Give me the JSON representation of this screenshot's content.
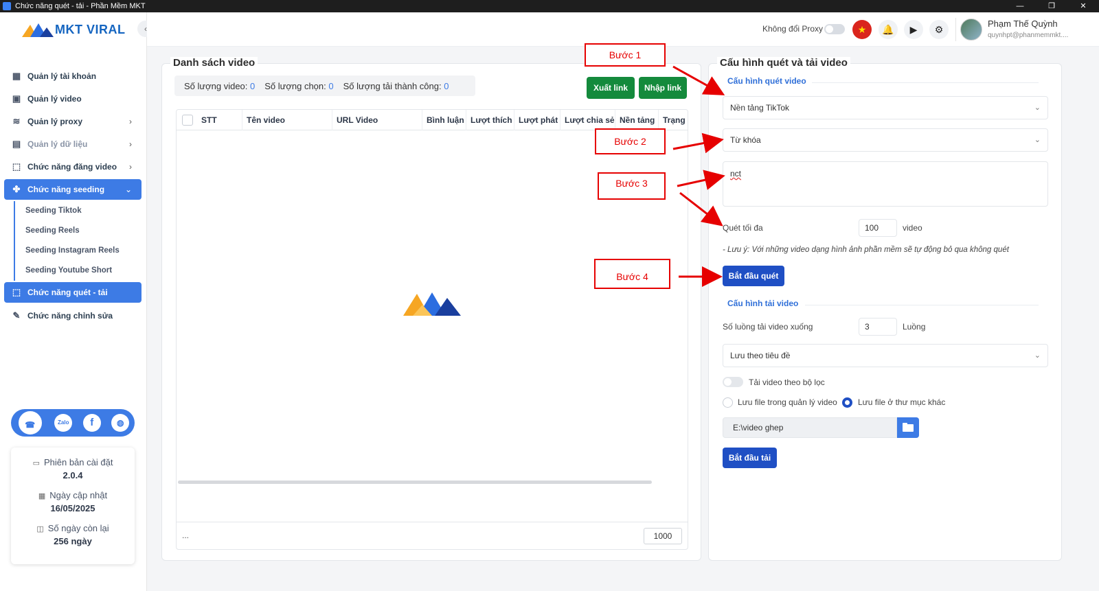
{
  "window": {
    "title": "Chức năng quét - tải - Phần Mềm MKT",
    "controls": [
      "—",
      "❐",
      "✕"
    ]
  },
  "brand": {
    "logo_text": "MKT VIRAL",
    "colors": {
      "orange": "#f6a623",
      "blue": "#1565c0"
    }
  },
  "sidebar": {
    "collapse_icon": "‹",
    "items": [
      {
        "label": "Quản lý tài khoản",
        "icon": "▦"
      },
      {
        "label": "Quản lý video",
        "icon": "▣"
      },
      {
        "label": "Quản lý proxy",
        "icon": "≋",
        "chevron": "›"
      },
      {
        "label": "Quản lý dữ liệu",
        "icon": "▤",
        "chevron": "›"
      },
      {
        "label": "Chức năng đăng video",
        "icon": "⬚",
        "chevron": "›"
      },
      {
        "label": "Chức năng seeding",
        "icon": "✤",
        "chevron": "⌄"
      }
    ],
    "sub_items": [
      "Seeding Tiktok",
      "Seeding Reels",
      "Seeding Instagram Reels",
      "Seeding Youtube Short"
    ],
    "items_after": [
      {
        "label": "Chức năng quét - tải",
        "icon": "⬚"
      },
      {
        "label": "Chức năng chỉnh sửa",
        "icon": "✎"
      }
    ],
    "social": [
      "☎",
      "Zalo",
      "f",
      "◍"
    ],
    "info": {
      "version_label": "Phiên bản cài đặt",
      "version": "2.0.4",
      "update_label": "Ngày cập nhật",
      "update_date": "16/05/2025",
      "days_label": "Số ngày còn lại",
      "days_value": "256 ngày"
    }
  },
  "header": {
    "proxy_label": "Không đổi Proxy",
    "flag": "★",
    "bell": "🔔",
    "play": "▶",
    "gear": "⚙",
    "user_name": "Phạm Thế Quỳnh",
    "user_email": "quynhpt@phanmemmkt...."
  },
  "left_panel": {
    "title": "Danh sách video",
    "count_video_label": "Số lượng video:",
    "count_video": "0",
    "count_selected_label": "Số lượng chọn:",
    "count_selected": "0",
    "count_success_label": "Số lượng tải thành công:",
    "count_success": "0",
    "export_label": "Xuất link",
    "import_label": "Nhập link",
    "columns": [
      "STT",
      "Tên video",
      "URL Video",
      "Bình luận",
      "Lượt thích",
      "Lượt phát",
      "Lượt chia sẻ",
      "Nền tảng",
      "Trạng"
    ],
    "footer_dots": "...",
    "page_size": "1000"
  },
  "right_panel": {
    "title": "Cấu hình quét và tải video",
    "scan_section": "Cấu hình quét video",
    "platform": "Nền tảng TikTok",
    "scan_type": "Từ khóa",
    "keyword": "nct",
    "max_scan_label": "Quét tối đa",
    "max_scan_value": "100",
    "max_scan_unit": "video",
    "note": "- Lưu ý: Với những video dạng hình ảnh phần mềm sẽ tự động bỏ qua không quét",
    "start_scan": "Bắt đầu quét",
    "download_section": "Cấu hình tải video",
    "threads_label": "Số luồng tải video xuống",
    "threads_value": "3",
    "threads_unit": "Luồng",
    "save_mode": "Lưu theo tiêu đề",
    "filter_label": "Tải video theo bộ lọc",
    "radio_manage": "Lưu file trong quản lý video",
    "radio_other": "Lưu file ở thư mục khác",
    "folder_path": "E:\\video ghep",
    "start_download": "Bắt đầu tải"
  },
  "annotations": {
    "step1": "Bước 1",
    "step2": "Bước 2",
    "step3": "Bước 3",
    "step4": "Bước 4",
    "color": "#e60000"
  }
}
